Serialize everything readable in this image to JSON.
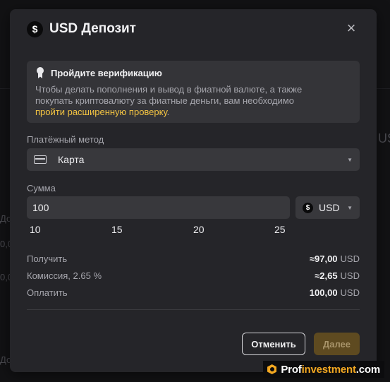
{
  "modal": {
    "title": "USD Депозит",
    "title_icon": "dollar-circle-icon",
    "close_icon": "close-icon"
  },
  "verification": {
    "icon": "medal-icon",
    "title": "Пройдите верификацию",
    "text_line1": "Чтобы делать пополнения и вывод в фиатной валюте, а также",
    "text_line2": "покупать криптовалюту за фиатные деньги, вам необходимо",
    "link": "пройти расширенную проверку",
    "text_end": "."
  },
  "payment_method": {
    "label": "Платёжный метод",
    "value": "Карта",
    "icon": "card-icon"
  },
  "amount": {
    "label": "Сумма",
    "value": "100",
    "currency": "USD",
    "currency_icon": "dollar-circle-icon",
    "quick_values": [
      "10",
      "15",
      "20",
      "25"
    ]
  },
  "summary": {
    "receive_label": "Получить",
    "receive_value": "≈97,00",
    "commission_label": "Комиссия, 2.65 %",
    "commission_value": "≈2,65",
    "pay_label": "Оплатить",
    "pay_value": "100,00",
    "currency": "USD"
  },
  "buttons": {
    "cancel": "Отменить",
    "next": "Далее"
  },
  "watermark": {
    "prefix": "Prof",
    "highlight": "investment",
    "suffix": ".com"
  },
  "background": {
    "text_a": "До",
    "text_b": "0,0",
    "text_c": "US"
  },
  "colors": {
    "modal_bg": "#252529",
    "accent_link": "#f5c542",
    "next_button_bg": "#5e4a20"
  }
}
